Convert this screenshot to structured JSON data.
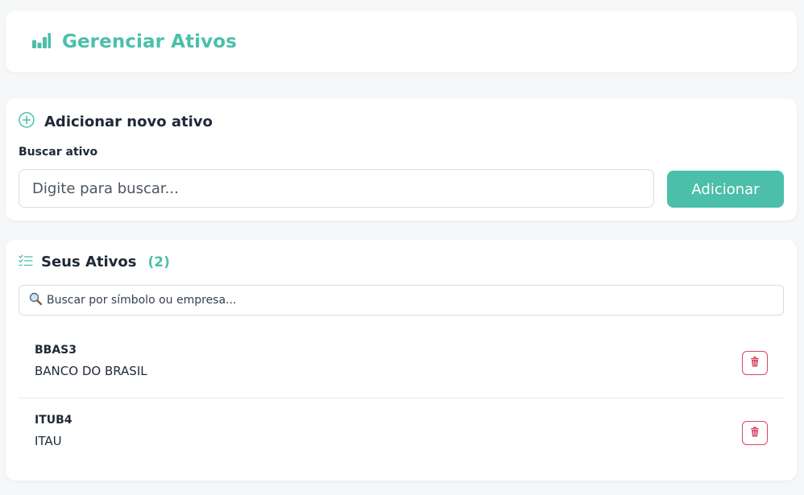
{
  "header": {
    "title": "Gerenciar Ativos",
    "icon": "bar-chart-icon"
  },
  "add_section": {
    "title": "Adicionar novo ativo",
    "icon": "plus-circle-icon",
    "field_label": "Buscar ativo",
    "search_placeholder": "Digite para buscar...",
    "search_value": "",
    "add_button_label": "Adicionar"
  },
  "list_section": {
    "title": "Seus Ativos",
    "icon": "list-check-icon",
    "count_label": "(2)",
    "filter_placeholder": "Buscar por símbolo ou empresa...",
    "filter_icon": "magnifier-icon",
    "items": [
      {
        "symbol": "BBAS3",
        "name": "BANCO DO BRASIL"
      },
      {
        "symbol": "ITUB4",
        "name": "ITAU"
      }
    ]
  },
  "colors": {
    "accent": "#4bbfa9",
    "danger": "#d9455f",
    "text": "#1f2937",
    "background": "#f6f7f9"
  }
}
